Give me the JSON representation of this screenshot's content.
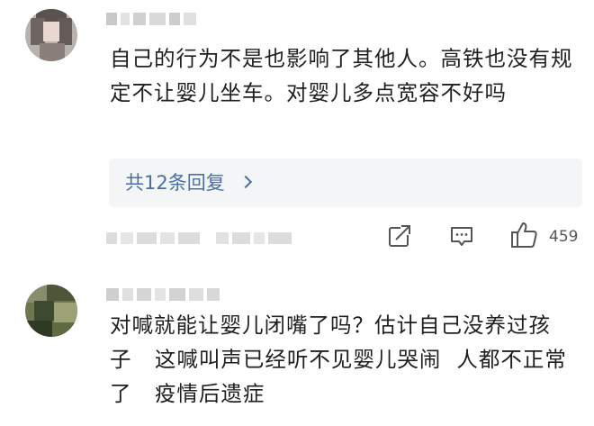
{
  "comments": [
    {
      "text": "自己的行为不是也影响了其他人。高铁也没有规定不让婴儿坐车。对婴儿多点宽容不好吗",
      "replies_label": "共12条回复",
      "like_count": "459"
    },
    {
      "text": "对喊就能让婴儿闭嘴了吗？估计自己没养过孩子   这喊叫声已经听不见婴儿哭闹  人都不正常了   疫情后遗症"
    }
  ],
  "icons": {
    "share": "share-icon",
    "comment": "comment-icon",
    "like": "thumbs-up-icon",
    "chevron": "chevron-right-icon"
  },
  "colors": {
    "text": "#1f1f1f",
    "link": "#4a6fa3",
    "reply_box_bg": "#f4f5f7",
    "icon": "#555555"
  }
}
